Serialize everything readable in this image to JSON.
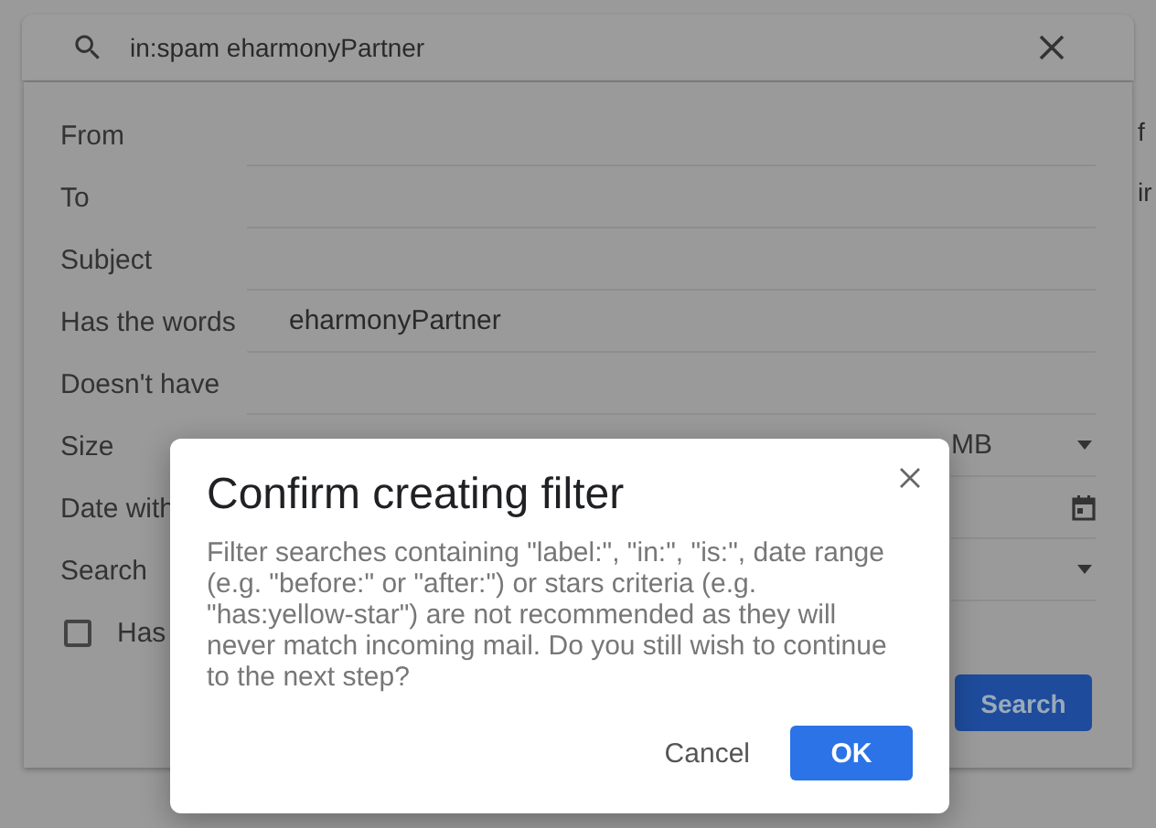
{
  "search_bar": {
    "query": "in:spam eharmonyPartner"
  },
  "filter_form": {
    "rows": [
      {
        "label": "From",
        "kind": "text"
      },
      {
        "label": "To",
        "kind": "text"
      },
      {
        "label": "Subject",
        "kind": "text"
      },
      {
        "label": "Has the words",
        "kind": "text",
        "value": "eharmonyPartner"
      },
      {
        "label": "Doesn't have",
        "kind": "text"
      },
      {
        "label": "Size",
        "kind": "select",
        "unit": "MB"
      },
      {
        "label": "Date with",
        "kind": "date"
      },
      {
        "label": "Search",
        "kind": "select"
      }
    ],
    "checkbox": {
      "label": "Has",
      "checked": false
    },
    "search_button": "Search"
  },
  "background_fragments": [
    "f",
    "ir"
  ],
  "dialog": {
    "title": "Confirm creating filter",
    "message": "Filter searches containing \"label:\", \"in:\", \"is:\", date range (e.g. \"before:\" or \"after:\") or stars criteria (e.g. \"has:yellow-star\") are not recommended as they will never match incoming mail. Do you still wish to continue to the next step?",
    "buttons": [
      {
        "label": "Cancel",
        "kind": "text"
      },
      {
        "label": "OK",
        "kind": "primary"
      }
    ]
  }
}
